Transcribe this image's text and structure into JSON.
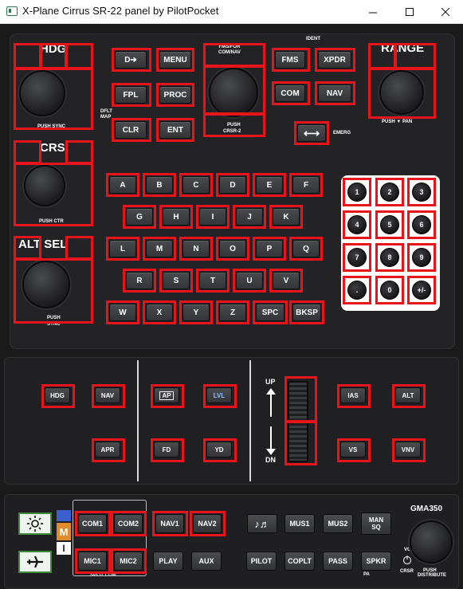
{
  "window": {
    "title": "X-Plane Cirrus SR-22 panel by PilotPocket"
  },
  "fms": {
    "hdg_label": "HDG",
    "hdg_push": "PUSH SYNC",
    "crs_label": "CRS",
    "crs_push": "PUSH CTR",
    "alt_label": "ALT SEL",
    "alt_push_1": "PUSH",
    "alt_push_2": "SYNC",
    "fms_knob_top": "FMS/FOR\nCOM/NAV",
    "fms_knob_push_1": "PUSH",
    "fms_knob_push_2": "CRSR-2",
    "range_label": "RANGE",
    "range_push": "PUSH ▼ PAN",
    "ident_label": "IDENT",
    "emerg_label": "EMERG",
    "dflt_map_1": "DFLT",
    "dflt_map_2": "MAP",
    "keys": {
      "direct": "D➔",
      "menu": "MENU",
      "fpl": "FPL",
      "proc": "PROC",
      "clr": "CLR",
      "ent": "ENT",
      "fms": "FMS",
      "xpdr": "XPDR",
      "com": "COM",
      "nav": "NAV",
      "swap": "⟷"
    },
    "alpha_rows": [
      [
        "A",
        "B",
        "C",
        "D",
        "E",
        "F"
      ],
      [
        "G",
        "H",
        "I",
        "J",
        "K"
      ],
      [
        "L",
        "M",
        "N",
        "O",
        "P",
        "Q"
      ],
      [
        "R",
        "S",
        "T",
        "U",
        "V"
      ],
      [
        "W",
        "X",
        "Y",
        "Z",
        "SPC",
        "BKSP"
      ]
    ],
    "numpad": [
      "1",
      "2",
      "3",
      "4",
      "5",
      "6",
      "7",
      "8",
      "9",
      ".",
      "0",
      "+/-"
    ]
  },
  "autopilot": {
    "hdg": "HDG",
    "nav": "NAV",
    "ap": "AP",
    "lvl": "LVL",
    "apr": "APR",
    "fd": "FD",
    "yd": "YD",
    "up": "UP",
    "dn": "DN",
    "ias": "IAS",
    "alt": "ALT",
    "vs": "VS",
    "vnv": "VNV"
  },
  "audio": {
    "model": "GMA350",
    "keys": {
      "com1": "COM1",
      "com2": "COM2",
      "nav1": "NAV1",
      "nav2": "NAV2",
      "music": "♪♬",
      "mus1": "MUS1",
      "mus2": "MUS2",
      "man_sq_1": "MAN",
      "man_sq_2": "SQ",
      "mic1": "MIC1",
      "mic2": "MIC2",
      "play": "PLAY",
      "aux": "AUX",
      "pilot": "PILOT",
      "coplt": "COPLT",
      "pass": "PASS",
      "spkr": "SPKR"
    },
    "split_com": "SPLIT COM",
    "pa": "PA",
    "vol": "VOL",
    "crsr": "CRSR",
    "push_distribute_1": "PUSH",
    "push_distribute_2": "DISTRIBUTE",
    "m_label": "M",
    "i_label": "I"
  },
  "colors": {
    "highlight": "#e8141b",
    "lvl_accent": "#8fc4ff",
    "icon_border": "#3f8a3f"
  }
}
